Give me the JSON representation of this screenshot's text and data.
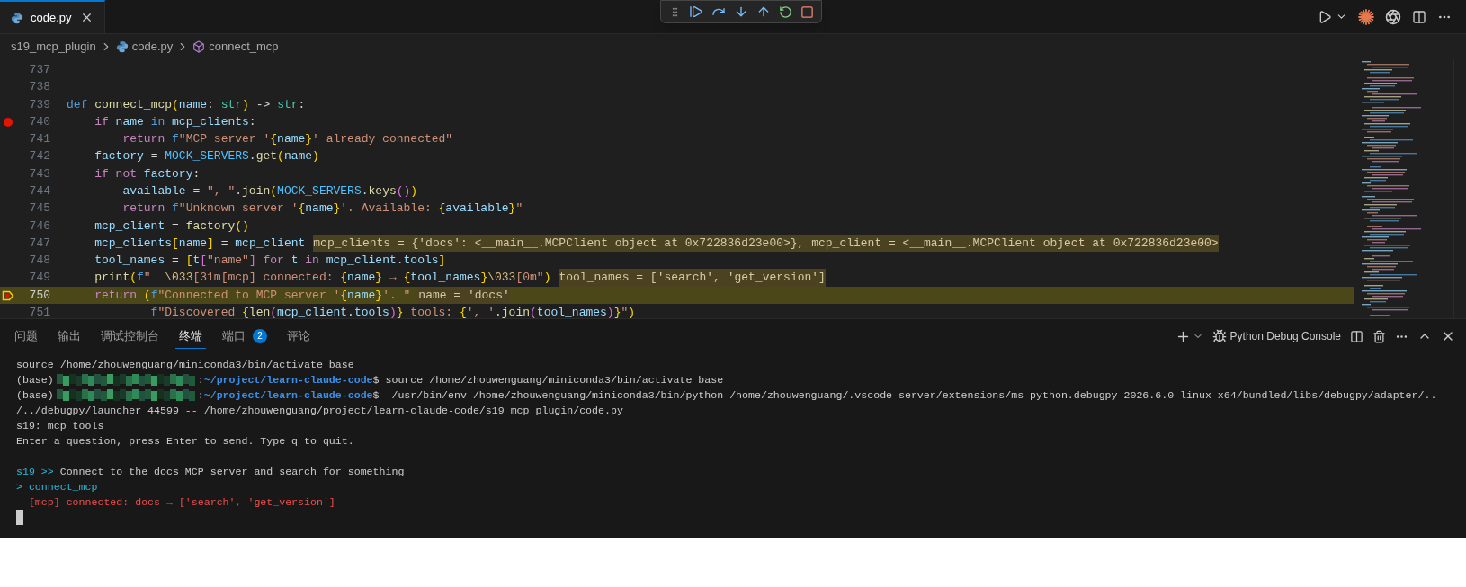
{
  "editor_tabs": [
    {
      "label": "code.py",
      "selected": true
    }
  ],
  "breadcrumb": [
    {
      "label": "s19_mcp_plugin",
      "kind": "folder"
    },
    {
      "label": "code.py",
      "kind": "file"
    },
    {
      "label": "connect_mcp",
      "kind": "symbol"
    }
  ],
  "code_lines": [
    {
      "number": "737",
      "breakpoint": false,
      "current": false
    },
    {
      "number": "738",
      "breakpoint": false,
      "current": false
    },
    {
      "number": "739",
      "breakpoint": false,
      "current": false,
      "tokens": [
        {
          "kind": "kw",
          "text": "def "
        },
        {
          "kind": "fn",
          "text": "connect_mcp"
        },
        {
          "kind": "br1",
          "text": "("
        },
        {
          "kind": "var",
          "text": "name"
        },
        {
          "kind": "op",
          "text": ": "
        },
        {
          "kind": "type",
          "text": "str"
        },
        {
          "kind": "br1",
          "text": ")"
        },
        {
          "kind": "op",
          "text": " -> "
        },
        {
          "kind": "type",
          "text": "str"
        },
        {
          "kind": "op",
          "text": ":"
        }
      ]
    },
    {
      "number": "740",
      "breakpoint": true,
      "current": false,
      "tokens": [
        {
          "kind": "ctrl",
          "text": "    if "
        },
        {
          "kind": "var",
          "text": "name "
        },
        {
          "kind": "kw",
          "text": "in "
        },
        {
          "kind": "var",
          "text": "mcp_clients"
        },
        {
          "kind": "op",
          "text": ":"
        }
      ]
    },
    {
      "number": "741",
      "breakpoint": false,
      "current": false,
      "tokens": [
        {
          "kind": "ctrl",
          "text": "        return "
        },
        {
          "kind": "kw",
          "text": "f"
        },
        {
          "kind": "str",
          "text": "\"MCP server '"
        },
        {
          "kind": "br1",
          "text": "{"
        },
        {
          "kind": "var",
          "text": "name"
        },
        {
          "kind": "br1",
          "text": "}"
        },
        {
          "kind": "str",
          "text": "' already connected\""
        }
      ]
    },
    {
      "number": "742",
      "breakpoint": false,
      "current": false,
      "tokens": [
        {
          "kind": "var",
          "text": "    factory"
        },
        {
          "kind": "op",
          "text": " = "
        },
        {
          "kind": "const",
          "text": "MOCK_SERVERS"
        },
        {
          "kind": "op",
          "text": "."
        },
        {
          "kind": "fn",
          "text": "get"
        },
        {
          "kind": "br1",
          "text": "("
        },
        {
          "kind": "var",
          "text": "name"
        },
        {
          "kind": "br1",
          "text": ")"
        }
      ]
    },
    {
      "number": "743",
      "breakpoint": false,
      "current": false,
      "tokens": [
        {
          "kind": "ctrl",
          "text": "    if not "
        },
        {
          "kind": "var",
          "text": "factory"
        },
        {
          "kind": "op",
          "text": ":"
        }
      ]
    },
    {
      "number": "744",
      "breakpoint": false,
      "current": false,
      "tokens": [
        {
          "kind": "var",
          "text": "        available"
        },
        {
          "kind": "op",
          "text": " = "
        },
        {
          "kind": "str",
          "text": "\", \""
        },
        {
          "kind": "op",
          "text": "."
        },
        {
          "kind": "fn",
          "text": "join"
        },
        {
          "kind": "br1",
          "text": "("
        },
        {
          "kind": "const",
          "text": "MOCK_SERVERS"
        },
        {
          "kind": "op",
          "text": "."
        },
        {
          "kind": "fn",
          "text": "keys"
        },
        {
          "kind": "br2",
          "text": "()"
        },
        {
          "kind": "br1",
          "text": ")"
        }
      ]
    },
    {
      "number": "745",
      "breakpoint": false,
      "current": false,
      "tokens": [
        {
          "kind": "ctrl",
          "text": "        return "
        },
        {
          "kind": "kw",
          "text": "f"
        },
        {
          "kind": "str",
          "text": "\"Unknown server '"
        },
        {
          "kind": "br1",
          "text": "{"
        },
        {
          "kind": "var",
          "text": "name"
        },
        {
          "kind": "br1",
          "text": "}"
        },
        {
          "kind": "str",
          "text": "'. Available: "
        },
        {
          "kind": "br1",
          "text": "{"
        },
        {
          "kind": "var",
          "text": "available"
        },
        {
          "kind": "br1",
          "text": "}"
        },
        {
          "kind": "str",
          "text": "\""
        }
      ]
    },
    {
      "number": "746",
      "breakpoint": false,
      "current": false,
      "tokens": [
        {
          "kind": "var",
          "text": "    mcp_client"
        },
        {
          "kind": "op",
          "text": " = "
        },
        {
          "kind": "fn",
          "text": "factory"
        },
        {
          "kind": "br1",
          "text": "()"
        }
      ]
    },
    {
      "number": "747",
      "breakpoint": false,
      "current": false,
      "inline_value": "mcp_clients = {'docs': <__main__.MCPClient object at 0x722836d23e00>}, mcp_client = <__main__.MCPClient object at 0x722836d23e00>",
      "tokens": [
        {
          "kind": "var",
          "text": "    mcp_clients"
        },
        {
          "kind": "br1",
          "text": "["
        },
        {
          "kind": "var",
          "text": "name"
        },
        {
          "kind": "br1",
          "text": "]"
        },
        {
          "kind": "op",
          "text": " = "
        },
        {
          "kind": "var",
          "text": "mcp_client"
        }
      ]
    },
    {
      "number": "748",
      "breakpoint": false,
      "current": false,
      "tokens": [
        {
          "kind": "var",
          "text": "    tool_names"
        },
        {
          "kind": "op",
          "text": " = "
        },
        {
          "kind": "br1",
          "text": "["
        },
        {
          "kind": "var",
          "text": "t"
        },
        {
          "kind": "br2",
          "text": "["
        },
        {
          "kind": "str",
          "text": "\"name\""
        },
        {
          "kind": "br2",
          "text": "]"
        },
        {
          "kind": "ctrl",
          "text": " for "
        },
        {
          "kind": "var",
          "text": "t "
        },
        {
          "kind": "ctrl",
          "text": "in "
        },
        {
          "kind": "var",
          "text": "mcp_client"
        },
        {
          "kind": "op",
          "text": "."
        },
        {
          "kind": "var",
          "text": "tools"
        },
        {
          "kind": "br1",
          "text": "]"
        }
      ]
    },
    {
      "number": "749",
      "breakpoint": false,
      "current": false,
      "inline_value": "tool_names = ['search', 'get_version']",
      "tokens": [
        {
          "kind": "fn",
          "text": "    print"
        },
        {
          "kind": "br1",
          "text": "("
        },
        {
          "kind": "kw",
          "text": "f"
        },
        {
          "kind": "str",
          "text": "\"  "
        },
        {
          "kind": "esc",
          "text": "\\033"
        },
        {
          "kind": "str",
          "text": "[31m[mcp] connected: "
        },
        {
          "kind": "br1",
          "text": "{"
        },
        {
          "kind": "var",
          "text": "name"
        },
        {
          "kind": "br1",
          "text": "}"
        },
        {
          "kind": "str",
          "text": " → "
        },
        {
          "kind": "br1",
          "text": "{"
        },
        {
          "kind": "var",
          "text": "tool_names"
        },
        {
          "kind": "br1",
          "text": "}"
        },
        {
          "kind": "esc",
          "text": "\\033"
        },
        {
          "kind": "str",
          "text": "[0m\""
        },
        {
          "kind": "br1",
          "text": ")"
        }
      ]
    },
    {
      "number": "750",
      "breakpoint": false,
      "current": true,
      "inline_value": "name = 'docs'",
      "tokens": [
        {
          "kind": "ctrl",
          "text": "    return "
        },
        {
          "kind": "br1",
          "text": "("
        },
        {
          "kind": "kw",
          "text": "f"
        },
        {
          "kind": "str",
          "text": "\"Connected to MCP server '"
        },
        {
          "kind": "br1",
          "text": "{"
        },
        {
          "kind": "var",
          "text": "name"
        },
        {
          "kind": "br1",
          "text": "}"
        },
        {
          "kind": "str",
          "text": "'. \""
        }
      ]
    },
    {
      "number": "751",
      "breakpoint": false,
      "current": false,
      "tokens": [
        {
          "kind": "kw",
          "text": "            f"
        },
        {
          "kind": "str",
          "text": "\"Discovered "
        },
        {
          "kind": "br1",
          "text": "{"
        },
        {
          "kind": "fn",
          "text": "len"
        },
        {
          "kind": "br2",
          "text": "("
        },
        {
          "kind": "var",
          "text": "mcp_client"
        },
        {
          "kind": "op",
          "text": "."
        },
        {
          "kind": "var",
          "text": "tools"
        },
        {
          "kind": "br2",
          "text": ")"
        },
        {
          "kind": "br1",
          "text": "}"
        },
        {
          "kind": "str",
          "text": " tools: "
        },
        {
          "kind": "br1",
          "text": "{"
        },
        {
          "kind": "str",
          "text": "', '"
        },
        {
          "kind": "op",
          "text": "."
        },
        {
          "kind": "fn",
          "text": "join"
        },
        {
          "kind": "br2",
          "text": "("
        },
        {
          "kind": "var",
          "text": "tool_names"
        },
        {
          "kind": "br2",
          "text": ")"
        },
        {
          "kind": "br1",
          "text": "}"
        },
        {
          "kind": "str",
          "text": "\""
        },
        {
          "kind": "br1",
          "text": ")"
        }
      ]
    }
  ],
  "panel": {
    "tabs": [
      {
        "label": "问题",
        "selected": false
      },
      {
        "label": "输出",
        "selected": false
      },
      {
        "label": "调试控制台",
        "selected": false
      },
      {
        "label": "终端",
        "selected": true
      },
      {
        "label": "端口",
        "selected": false,
        "badge": "2"
      },
      {
        "label": "评论",
        "selected": false
      }
    ],
    "terminal_name": "Python Debug Console",
    "terminal_lines": [
      {
        "kind": "plain",
        "text": "source /home/zhouwenguang/miniconda3/bin/activate base"
      },
      {
        "kind": "prompt",
        "prefix": "(base)",
        "separator": ":",
        "path": "~/project/learn-claude-code",
        "command": "$ source /home/zhouwenguang/miniconda3/bin/activate base"
      },
      {
        "kind": "prompt",
        "prefix": "(base)",
        "separator": ":",
        "path": "~/project/learn-claude-code",
        "command": "$  /usr/bin/env /home/zhouwenguang/miniconda3/bin/python /home/zhouwenguang/.vscode-server/extensions/ms-python.debugpy-2026.6.0-linux-x64/bundled/libs/debugpy/adapter/.."
      },
      {
        "kind": "plain",
        "text": "/../debugpy/launcher 44599 -- /home/zhouwenguang/project/learn-claude-code/s19_mcp_plugin/code.py"
      },
      {
        "kind": "plain",
        "text": "s19: mcp tools"
      },
      {
        "kind": "plain",
        "text": "Enter a question, press Enter to send. Type q to quit."
      },
      {
        "kind": "blank"
      },
      {
        "kind": "input",
        "prompt": "s19 >>",
        "text": " Connect to the docs MCP server and search for something"
      },
      {
        "kind": "tool",
        "text": "> connect_mcp"
      },
      {
        "kind": "error",
        "text": "  [mcp] connected: docs → ['search', 'get_version']"
      },
      {
        "kind": "cursor"
      }
    ]
  }
}
